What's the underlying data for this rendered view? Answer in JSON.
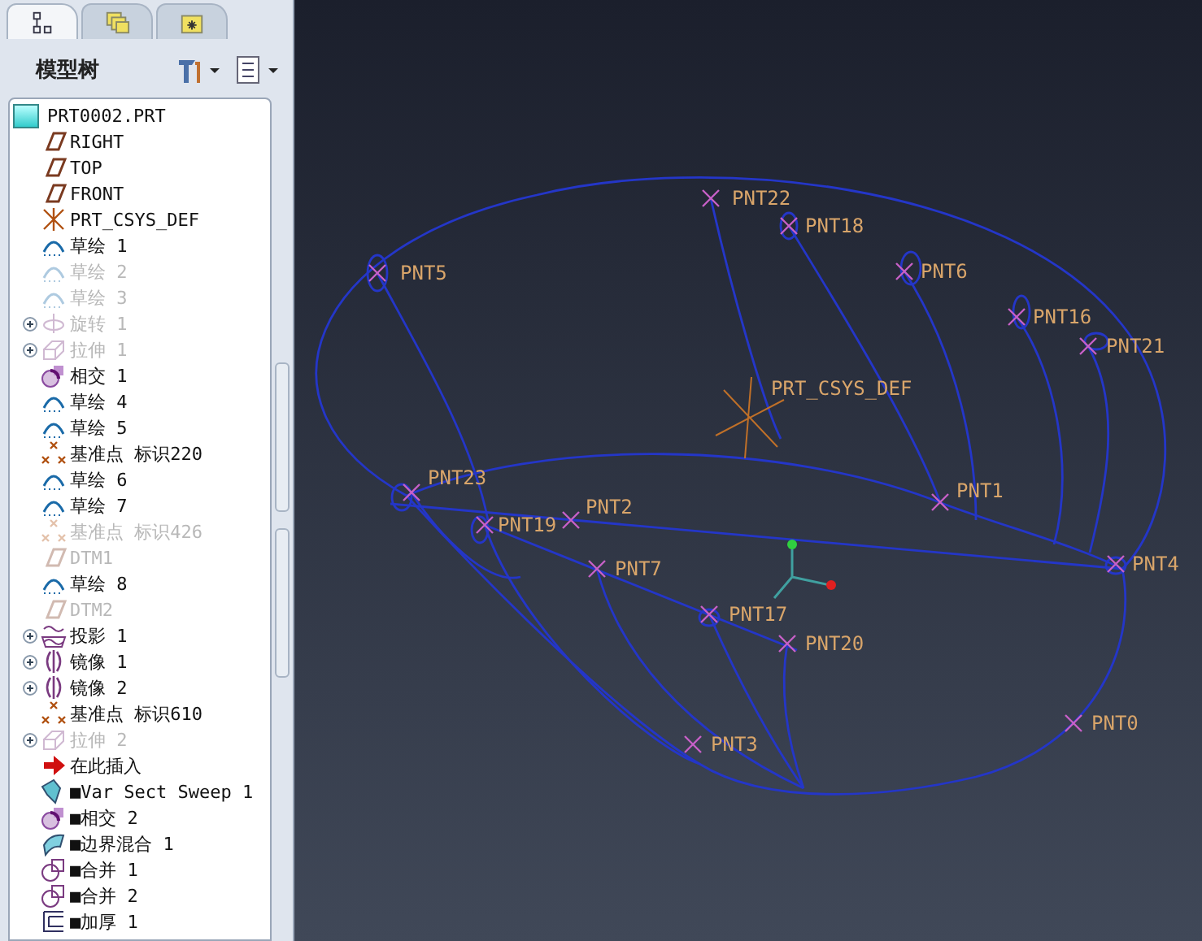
{
  "navigator": {
    "tabs": [
      {
        "kind": "tree",
        "selected": true
      },
      {
        "kind": "layers",
        "selected": false
      },
      {
        "kind": "folder",
        "selected": false
      }
    ],
    "title": "模型树",
    "tree": {
      "root": "PRT0002.PRT",
      "items": [
        {
          "label": "RIGHT",
          "kind": "plane",
          "suppressed": false,
          "expandable": false
        },
        {
          "label": "TOP",
          "kind": "plane",
          "suppressed": false,
          "expandable": false
        },
        {
          "label": "FRONT",
          "kind": "plane",
          "suppressed": false,
          "expandable": false
        },
        {
          "label": "PRT_CSYS_DEF",
          "kind": "csys",
          "suppressed": false,
          "expandable": false
        },
        {
          "label": "草绘 1",
          "kind": "sketch",
          "suppressed": false,
          "expandable": false
        },
        {
          "label": "草绘 2",
          "kind": "sketch",
          "suppressed": true,
          "expandable": false
        },
        {
          "label": "草绘 3",
          "kind": "sketch",
          "suppressed": true,
          "expandable": false
        },
        {
          "label": "旋转 1",
          "kind": "revolve",
          "suppressed": true,
          "expandable": true
        },
        {
          "label": "拉伸 1",
          "kind": "extrude",
          "suppressed": true,
          "expandable": true
        },
        {
          "label": "相交 1",
          "kind": "intersect",
          "suppressed": false,
          "expandable": false
        },
        {
          "label": "草绘 4",
          "kind": "sketch",
          "suppressed": false,
          "expandable": false
        },
        {
          "label": "草绘 5",
          "kind": "sketch",
          "suppressed": false,
          "expandable": false
        },
        {
          "label": "基准点 标识220",
          "kind": "point",
          "suppressed": false,
          "expandable": false
        },
        {
          "label": "草绘 6",
          "kind": "sketch",
          "suppressed": false,
          "expandable": false
        },
        {
          "label": "草绘 7",
          "kind": "sketch",
          "suppressed": false,
          "expandable": false
        },
        {
          "label": "基准点 标识426",
          "kind": "point",
          "suppressed": true,
          "expandable": false
        },
        {
          "label": "DTM1",
          "kind": "plane",
          "suppressed": true,
          "expandable": false
        },
        {
          "label": "草绘 8",
          "kind": "sketch",
          "suppressed": false,
          "expandable": false
        },
        {
          "label": "DTM2",
          "kind": "plane",
          "suppressed": true,
          "expandable": false
        },
        {
          "label": "投影 1",
          "kind": "projection",
          "suppressed": false,
          "expandable": true
        },
        {
          "label": "镜像 1",
          "kind": "mirror",
          "suppressed": false,
          "expandable": true
        },
        {
          "label": "镜像 2",
          "kind": "mirror",
          "suppressed": false,
          "expandable": true
        },
        {
          "label": "基准点 标识610",
          "kind": "point",
          "suppressed": false,
          "expandable": false
        },
        {
          "label": "拉伸 2",
          "kind": "extrude",
          "suppressed": true,
          "expandable": true
        },
        {
          "label": "在此插入",
          "kind": "insert",
          "suppressed": false,
          "expandable": false
        },
        {
          "label": "■Var Sect Sweep 1",
          "kind": "sweep",
          "suppressed": false,
          "expandable": false
        },
        {
          "label": "■相交 2",
          "kind": "intersect",
          "suppressed": false,
          "expandable": false
        },
        {
          "label": "■边界混合 1",
          "kind": "blend",
          "suppressed": false,
          "expandable": false
        },
        {
          "label": "■合并 1",
          "kind": "merge",
          "suppressed": false,
          "expandable": false
        },
        {
          "label": "■合并 2",
          "kind": "merge",
          "suppressed": false,
          "expandable": false
        },
        {
          "label": "■加厚 1",
          "kind": "thicken",
          "suppressed": false,
          "expandable": false
        }
      ]
    }
  },
  "viewport": {
    "csys_label": "PRT_CSYS_DEF",
    "points": [
      "PNT22",
      "PNT18",
      "PNT5",
      "PNT6",
      "PNT16",
      "PNT21",
      "PNT1",
      "PNT23",
      "PNT19",
      "PNT2",
      "PNT7",
      "PNT4",
      "PNT17",
      "PNT20",
      "PNT0",
      "PNT3"
    ]
  }
}
